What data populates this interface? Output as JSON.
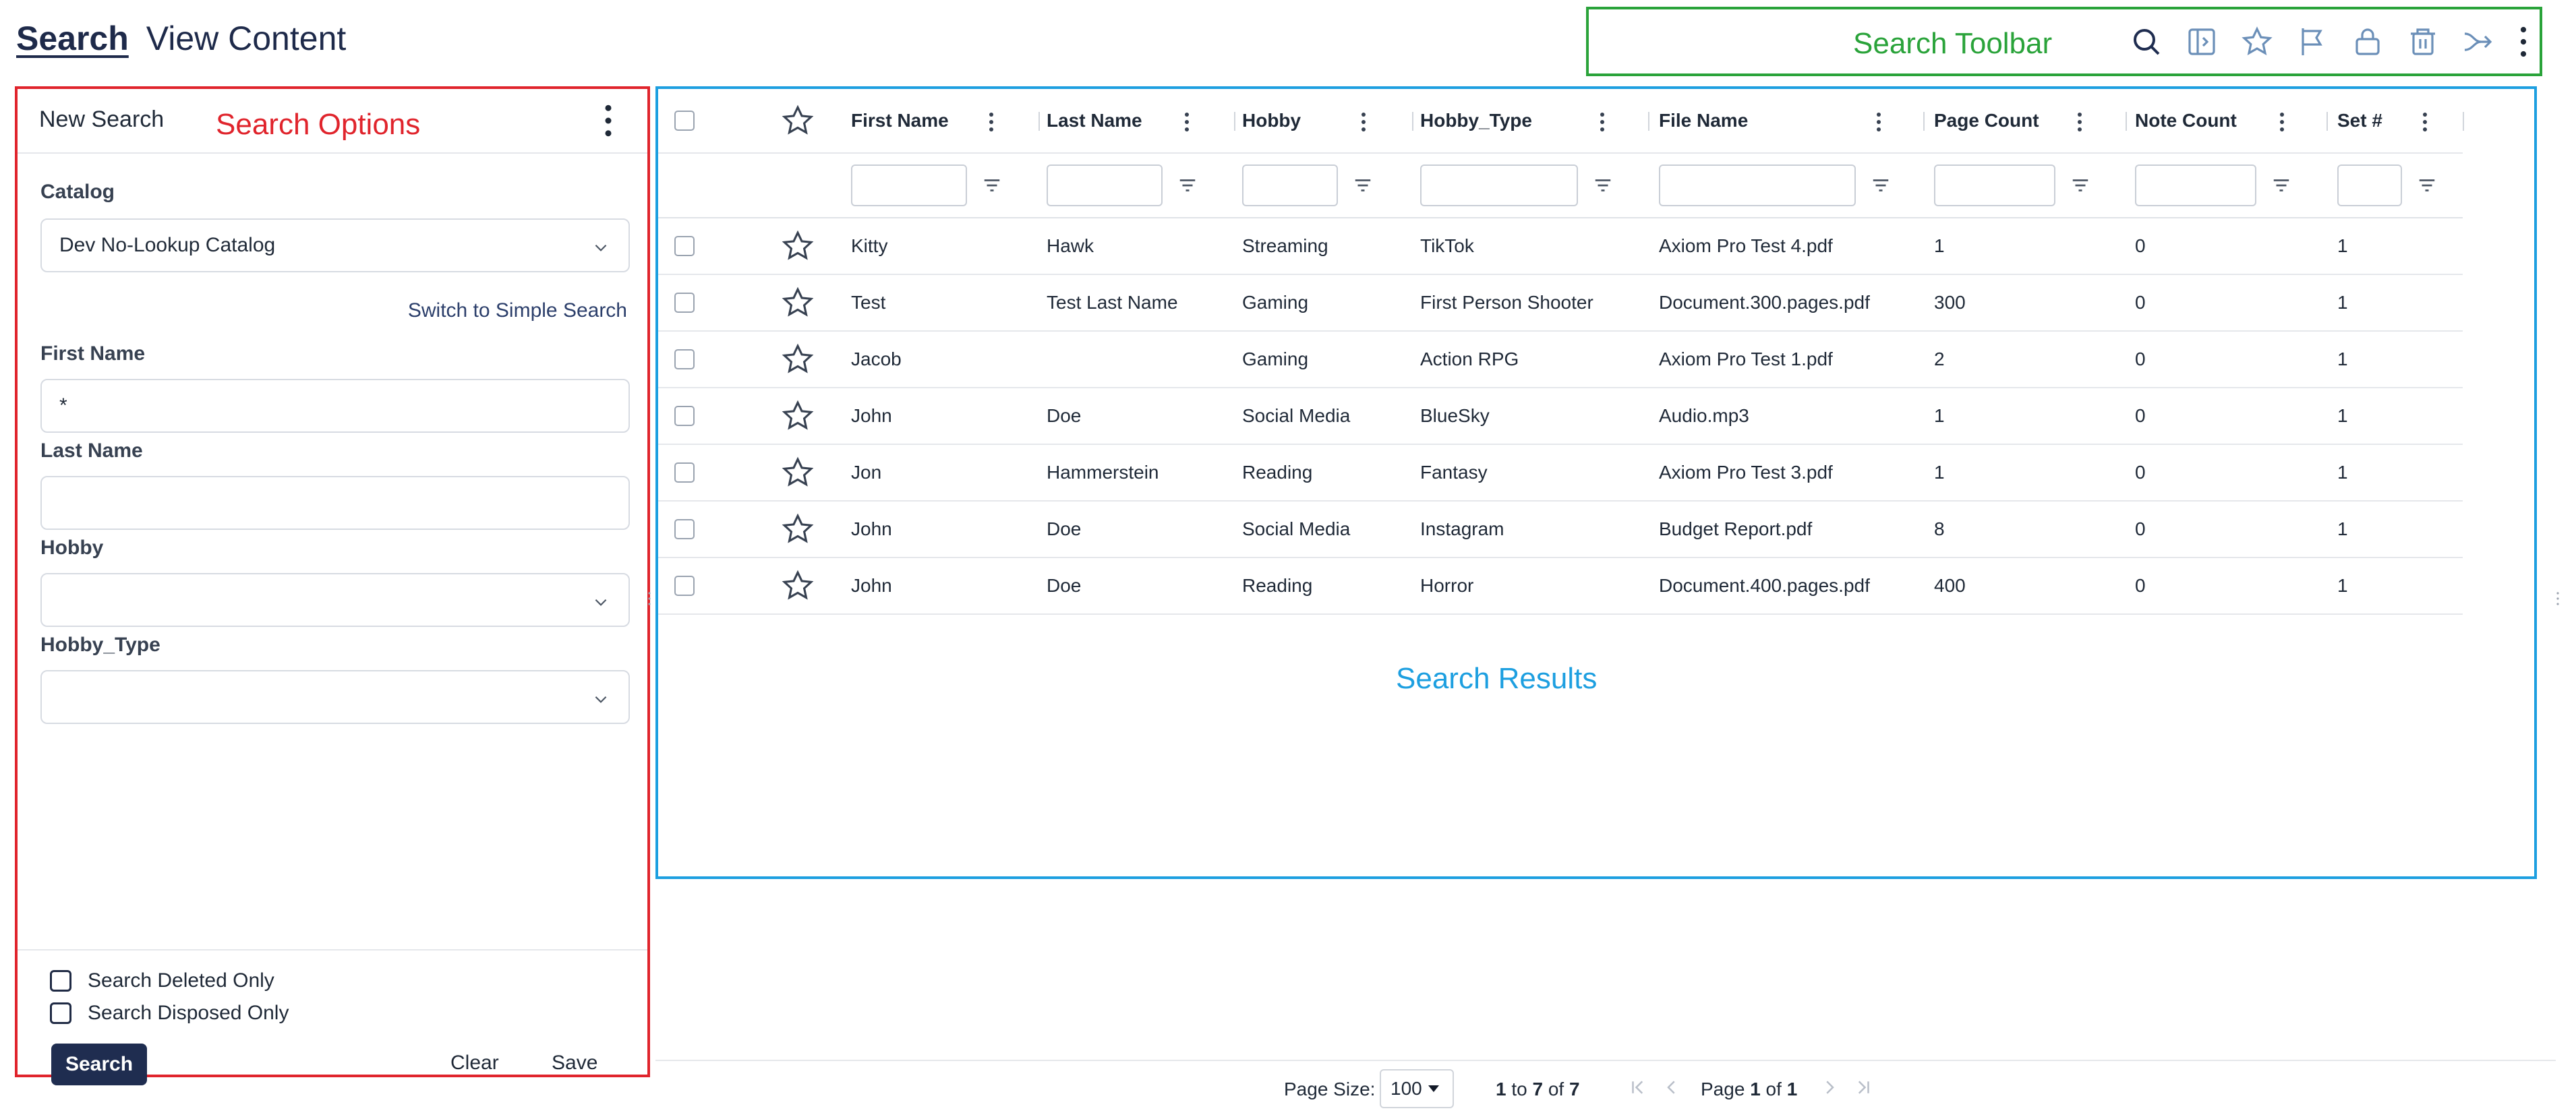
{
  "nav": {
    "search": "Search",
    "view_content": "View Content"
  },
  "toolbar": {
    "label": "Search Toolbar",
    "icons": [
      "search-icon",
      "sidebar-toggle-icon",
      "star-icon",
      "flag-icon",
      "lock-icon",
      "trash-icon",
      "merge-arrow-icon",
      "kebab-menu-icon"
    ]
  },
  "search_options": {
    "title": "New Search",
    "annotation": "Search Options",
    "catalog_label": "Catalog",
    "catalog_value": "Dev No-Lookup Catalog",
    "switch_link": "Switch to Simple Search",
    "first_name_label": "First Name",
    "first_name_value": "*",
    "last_name_label": "Last Name",
    "last_name_value": "",
    "hobby_label": "Hobby",
    "hobby_value": "",
    "hobby_type_label": "Hobby_Type",
    "hobby_type_value": "",
    "deleted_only": "Search Deleted Only",
    "disposed_only": "Search Disposed Only",
    "search_button": "Search",
    "clear_button": "Clear",
    "save_button": "Save"
  },
  "results": {
    "annotation": "Search Results",
    "columns": [
      "First Name",
      "Last Name",
      "Hobby",
      "Hobby_Type",
      "File Name",
      "Page Count",
      "Note Count",
      "Set #"
    ],
    "rows": [
      [
        "Kitty",
        "Hawk",
        "Streaming",
        "TikTok",
        "Axiom Pro Test 4.pdf",
        "1",
        "0",
        "1"
      ],
      [
        "Test",
        "Test Last Name",
        "Gaming",
        "First Person Shooter",
        "Document.300.pages.pdf",
        "300",
        "0",
        "1"
      ],
      [
        "Jacob",
        "",
        "Gaming",
        "Action RPG",
        "Axiom Pro Test 1.pdf",
        "2",
        "0",
        "1"
      ],
      [
        "John",
        "Doe",
        "Social Media",
        "BlueSky",
        "Audio.mp3",
        "1",
        "0",
        "1"
      ],
      [
        "Jon",
        "Hammerstein",
        "Reading",
        "Fantasy",
        "Axiom Pro Test 3.pdf",
        "1",
        "0",
        "1"
      ],
      [
        "John",
        "Doe",
        "Social Media",
        "Instagram",
        "Budget Report.pdf",
        "8",
        "0",
        "1"
      ],
      [
        "John",
        "Doe",
        "Reading",
        "Horror",
        "Document.400.pages.pdf",
        "400",
        "0",
        "1"
      ]
    ]
  },
  "pagination": {
    "page_size_label": "Page Size:",
    "page_size_value": "100",
    "range_from": "1",
    "range_to": "7",
    "range_total": "7",
    "range_to_word": "to",
    "range_of_word": "of",
    "page_word": "Page",
    "page_current": "1",
    "page_of_word": "of",
    "page_total": "1"
  },
  "colors": {
    "accent_navy": "#1f2d50",
    "toolbar_annotation": "#2aa33a",
    "options_annotation": "#e0242c",
    "results_annotation": "#1d9fe0"
  }
}
